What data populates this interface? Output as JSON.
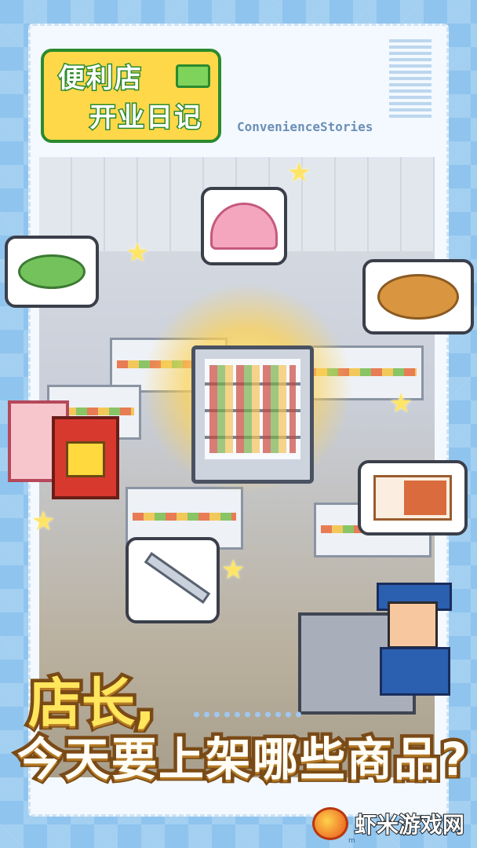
{
  "logo": {
    "line1": "便利店",
    "line2": "开业日记"
  },
  "subtitle": "ConvenienceStories",
  "headline": {
    "line1": "店长,",
    "line2": "今天要上架哪些商品?"
  },
  "watermark": {
    "text": "虾米游戏网",
    "url": "m"
  },
  "items": [
    "umbrella-icon",
    "salad-icon",
    "bread-icon",
    "bento-icon",
    "card-icon",
    "sword-icon",
    "showcase-fridge-icon"
  ],
  "colors": {
    "background": "#8fc4ee",
    "ticket": "#f3f9ff",
    "logo_fill": "#ffd84a",
    "logo_outline": "#2b8a2e",
    "headline_stroke": "#7a4a16"
  }
}
